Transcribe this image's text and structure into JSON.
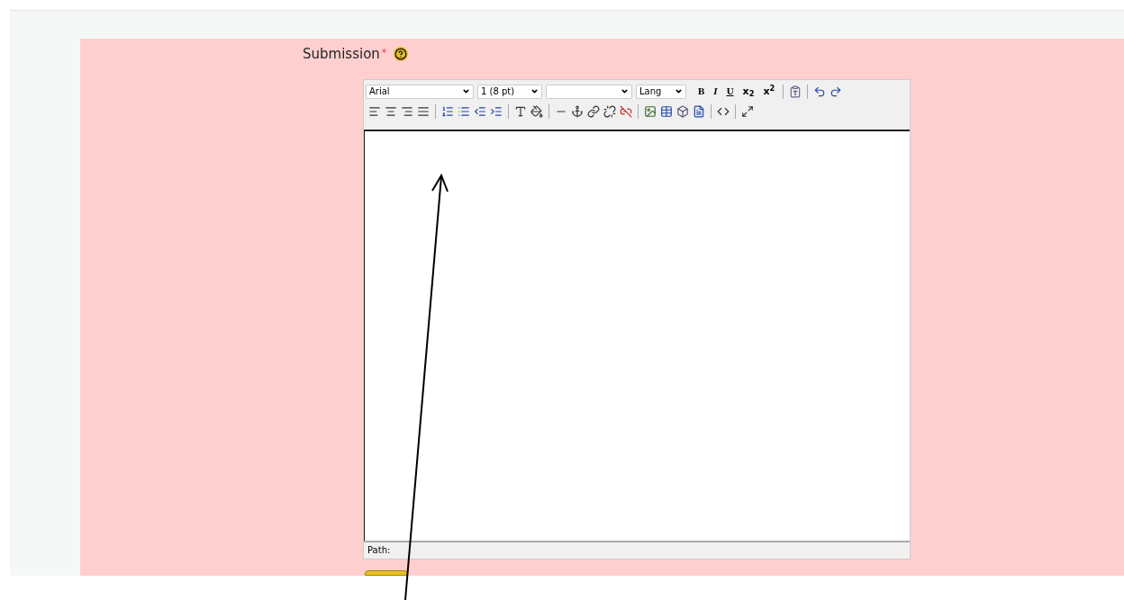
{
  "field": {
    "label": "Submission",
    "required_mark": "*"
  },
  "toolbar": {
    "font": "Arial",
    "size": "1 (8 pt)",
    "lang": "Lang",
    "format_buttons": [
      {
        "kind": "bold",
        "text": "B"
      },
      {
        "kind": "italic",
        "text": "I"
      },
      {
        "kind": "underline",
        "text": "U"
      },
      {
        "kind": "sub",
        "text": "x$_{2}$"
      },
      {
        "kind": "sup",
        "text": "x$^{2}$"
      }
    ]
  },
  "status_bar": {
    "path_label": "Path:"
  }
}
